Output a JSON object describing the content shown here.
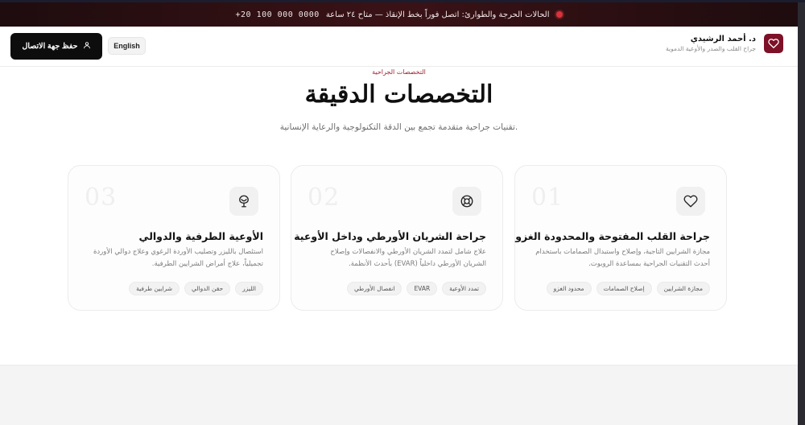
{
  "emergency": {
    "text": "الحالات الحرجة والطوارئ: اتصل فوراً بخط الإنقاذ — متاح ٢٤ ساعة",
    "phone": "+20 100 000 0000"
  },
  "header": {
    "brand_name": "د. أحمد الرشيدي",
    "brand_sub": "جراح القلب والصدر والأوعية الدموية",
    "language_label": "English",
    "cta_label": "حفظ جهة الاتصال"
  },
  "section": {
    "eyebrow": "التخصصات الجراحية",
    "title": "التخصصات الدقيقة",
    "subtitle": "تقنيات جراحية متقدمة تجمع بين الدقة التكنولوجية والرعاية الإنسانية."
  },
  "cards": [
    {
      "num": "01",
      "icon": "heart-icon",
      "title": "جراحة القلب المفتوحة والمحدودة الغزو",
      "desc": "مجازة الشرايين التاجية، وإصلاح واستبدال الصمامات باستخدام أحدث التقنيات الجراحية بمساعدة الروبوت.",
      "tags": [
        "مجازة الشرايين",
        "إصلاح الصمامات",
        "محدود الغزو"
      ]
    },
    {
      "num": "02",
      "icon": "lifebuoy-icon",
      "title": "جراحة الشريان الأورطي وداخل الأوعية",
      "desc": "علاج شامل لتمدد الشريان الأورطي والانفصالات وإصلاح الشريان الأورطي داخلياً (EVAR) بأحدث الأنظمة.",
      "tags": [
        "تمدد الأوعية",
        "EVAR",
        "انفصال الأورطي"
      ]
    },
    {
      "num": "03",
      "icon": "vessel-icon",
      "title": "الأوعية الطرفية والدوالي",
      "desc": "استئصال بالليزر وتصليب الأوردة الرغوي وعلاج دوالي الأوردة تجميلياً، علاج أمراض الشرايين الطرفية.",
      "tags": [
        "الليزر",
        "حقن الدوالي",
        "شرايين طرفية"
      ]
    }
  ],
  "colors": {
    "brand": "#7d1128",
    "accent_text": "#9b2335",
    "emergency_dot": "#d9323a"
  }
}
